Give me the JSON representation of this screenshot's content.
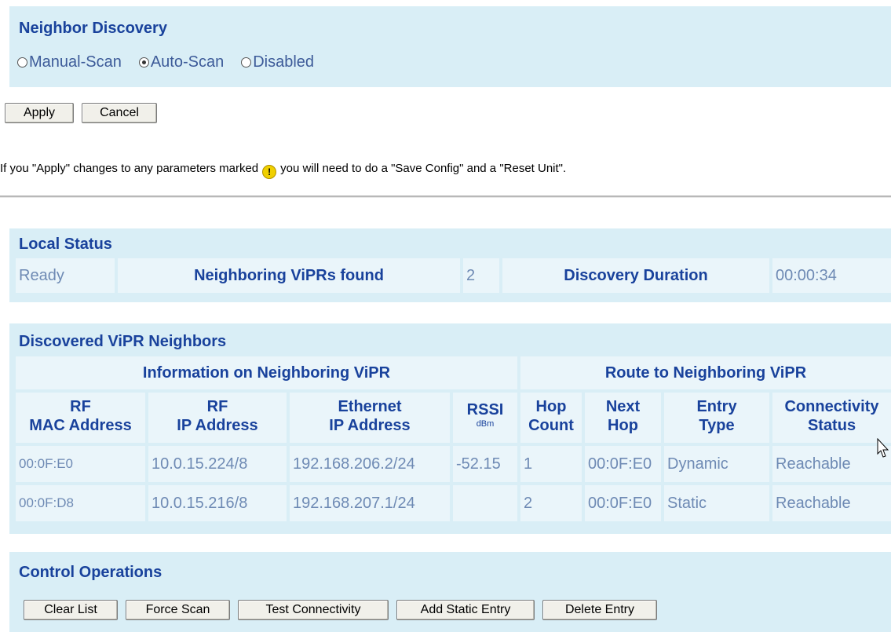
{
  "neighbor_discovery": {
    "title": "Neighbor Discovery",
    "options": [
      "Manual-Scan",
      "Auto-Scan",
      "Disabled"
    ],
    "selected": "Auto-Scan"
  },
  "form_buttons": {
    "apply": "Apply",
    "cancel": "Cancel"
  },
  "note": {
    "before": "If you \"Apply\" changes to any parameters marked",
    "after": "you will need to do a \"Save Config\" and a \"Reset Unit\".",
    "icon": "warning-icon"
  },
  "local_status": {
    "title": "Local Status",
    "status": "Ready",
    "neighbors_label": "Neighboring ViPRs found",
    "neighbors_count": "2",
    "duration_label": "Discovery Duration",
    "duration_value": "00:00:34"
  },
  "neighbors": {
    "title": "Discovered ViPR Neighbors",
    "group_info": "Information on Neighboring ViPR",
    "group_route": "Route to Neighboring ViPR",
    "columns": {
      "rf_mac": [
        "RF",
        "MAC Address"
      ],
      "rf_ip": [
        "RF",
        "IP Address"
      ],
      "eth_ip": [
        "Ethernet",
        "IP Address"
      ],
      "rssi": [
        "RSSI",
        "dBm"
      ],
      "hop": [
        "Hop",
        "Count"
      ],
      "next_hop": [
        "Next",
        "Hop"
      ],
      "entry_type": [
        "Entry",
        "Type"
      ],
      "connectivity": [
        "Connectivity",
        "Status"
      ]
    },
    "rows": [
      [
        "00:0F:E0",
        "10.0.15.224/8",
        "192.168.206.2/24",
        "-52.15",
        "1",
        "00:0F:E0",
        "Dynamic",
        "Reachable"
      ],
      [
        "00:0F:D8",
        "10.0.15.216/8",
        "192.168.207.1/24",
        "",
        "2",
        "00:0F:E0",
        "Static",
        "Reachable"
      ]
    ]
  },
  "control": {
    "title": "Control Operations",
    "buttons": [
      "Clear List",
      "Force Scan",
      "Test Connectivity",
      "Add Static Entry",
      "Delete Entry"
    ]
  },
  "colors": {
    "panel_bg": "#d9eef6",
    "cell_bg": "#eaf5fa",
    "header_text": "#19429c",
    "value_text": "#6e8ab4"
  }
}
